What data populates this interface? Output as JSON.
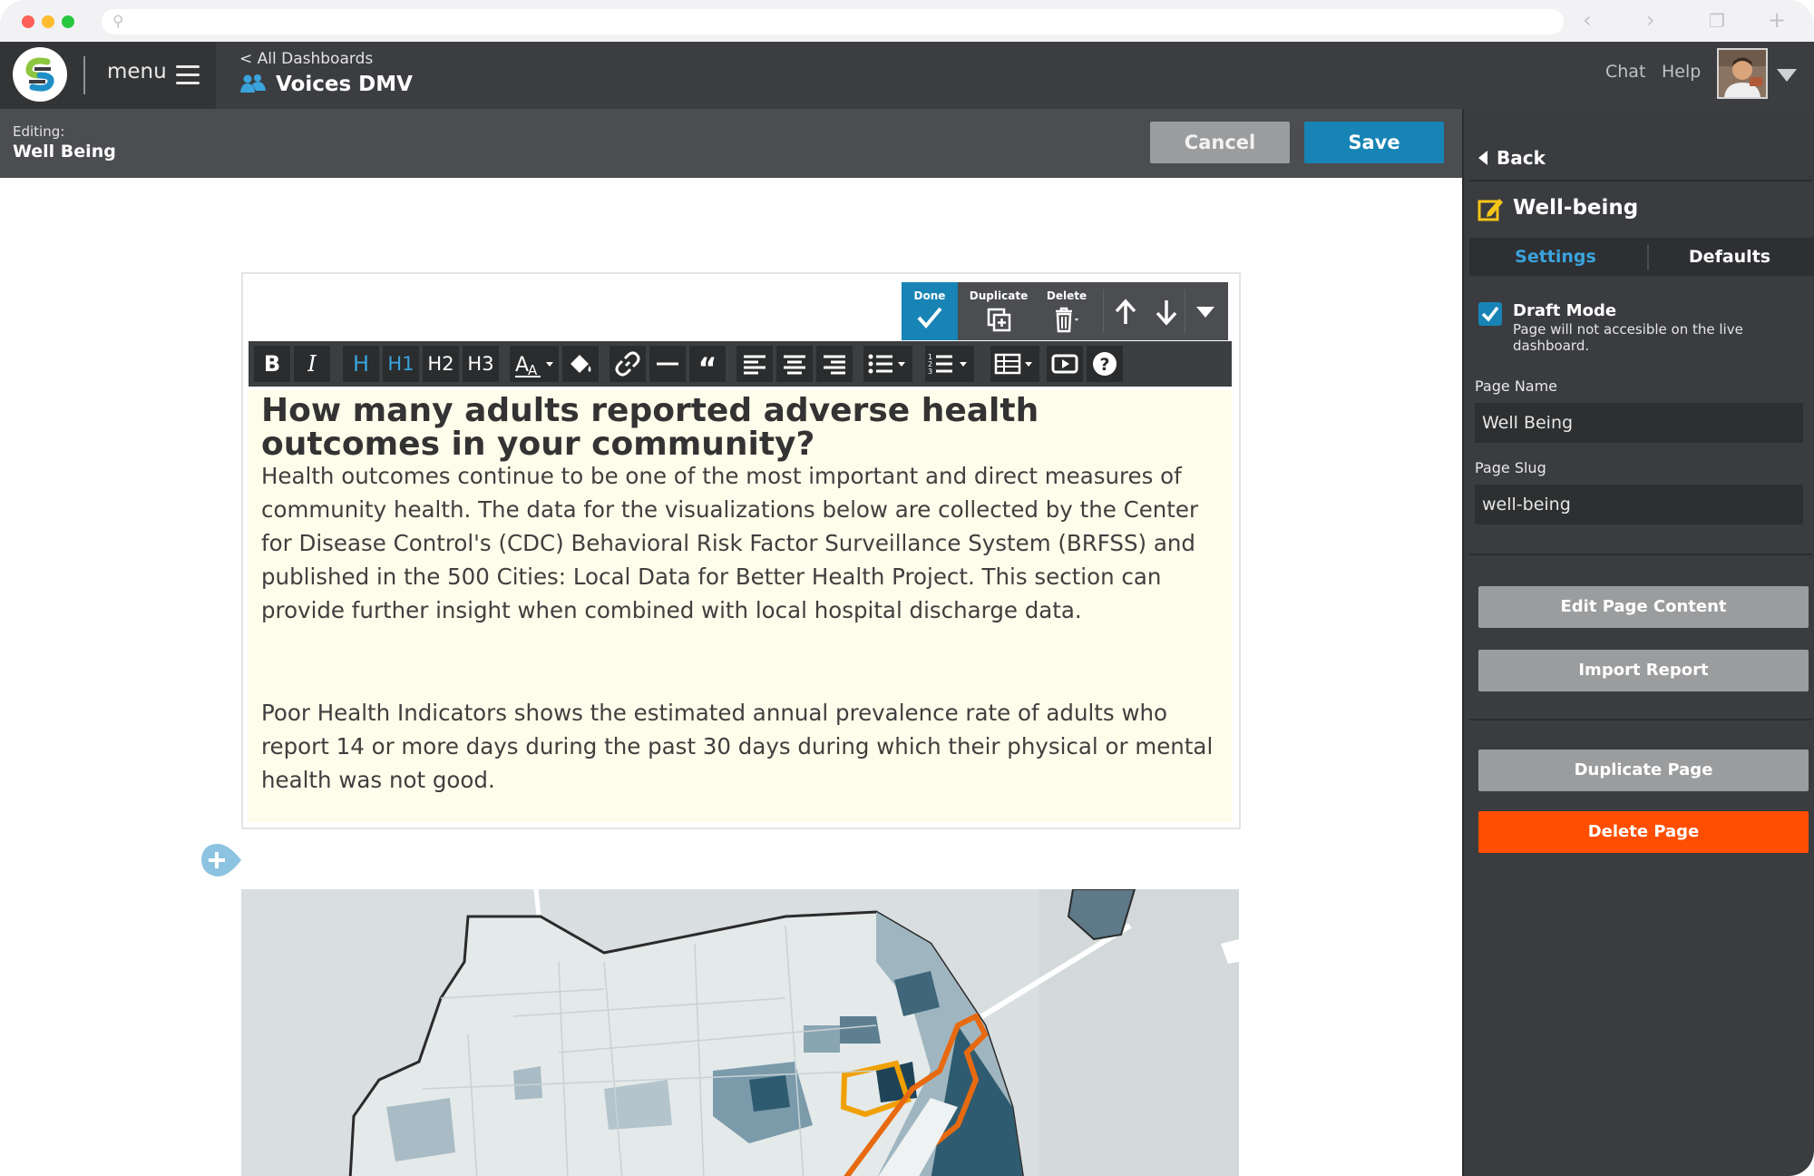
{
  "browser": {
    "address": ""
  },
  "header": {
    "menu_label": "menu",
    "breadcrumb": "< All Dashboards",
    "dashboard_title": "Voices DMV",
    "chat_label": "Chat",
    "help_label": "Help"
  },
  "editbar": {
    "editing_label": "Editing:",
    "page_name": "Well Being",
    "cancel_label": "Cancel",
    "save_label": "Save"
  },
  "block_controls": {
    "done_label": "Done",
    "duplicate_label": "Duplicate",
    "delete_label": "Delete"
  },
  "toolbar": {
    "bold": "B",
    "italic": "I",
    "heading": "H",
    "h1": "H1",
    "h2": "H2",
    "h3": "H3"
  },
  "content": {
    "heading": "How many adults reported adverse health outcomes in your community?",
    "paragraph1": "Health outcomes continue to be one of the most important and direct measures of community health. The data for the visualizations below are collected by the Center for Disease Control's (CDC) Behavioral Risk Factor Surveillance System (BRFSS) and published in the 500 Cities: Local Data for Better Health Project. This section can provide further insight when combined with local hospital discharge data.",
    "paragraph2": "Poor Health Indicators shows the estimated annual prevalence rate of adults who report 14 or more days during the past 30 days during which their physical or mental health was not good."
  },
  "panel": {
    "back_label": "Back",
    "page_title": "Well-being",
    "tabs": [
      "Settings",
      "Defaults"
    ],
    "draft_mode": {
      "title": "Draft Mode",
      "description": "Page will not accesible on the live dashboard.",
      "checked": true
    },
    "page_name_label": "Page Name",
    "page_name_value": "Well Being",
    "page_slug_label": "Page Slug",
    "page_slug_value": "well-being",
    "buttons": {
      "edit_content": "Edit Page Content",
      "import_report": "Import Report",
      "duplicate_page": "Duplicate Page",
      "delete_page": "Delete Page"
    }
  },
  "colors": {
    "accent_blue": "#1784b5",
    "danger_orange": "#ff4e00",
    "dark_header": "#3b3d40",
    "editor_background": "#fefcea"
  },
  "icons": [
    "search-icon",
    "back-arrow-icon",
    "forward-arrow-icon",
    "tabs-icon",
    "new-tab-icon",
    "app-logo-icon",
    "hamburger-icon",
    "people-icon",
    "user-avatar",
    "dropdown-caret-icon",
    "checkmark-icon",
    "duplicate-icon",
    "trash-icon",
    "arrow-up-icon",
    "arrow-down-icon",
    "link-icon",
    "quote-icon",
    "align-left-icon",
    "align-center-icon",
    "align-right-icon",
    "bullet-list-icon",
    "numbered-list-icon",
    "table-icon",
    "video-icon",
    "help-circle-icon",
    "add-block-icon",
    "edit-page-icon"
  ]
}
